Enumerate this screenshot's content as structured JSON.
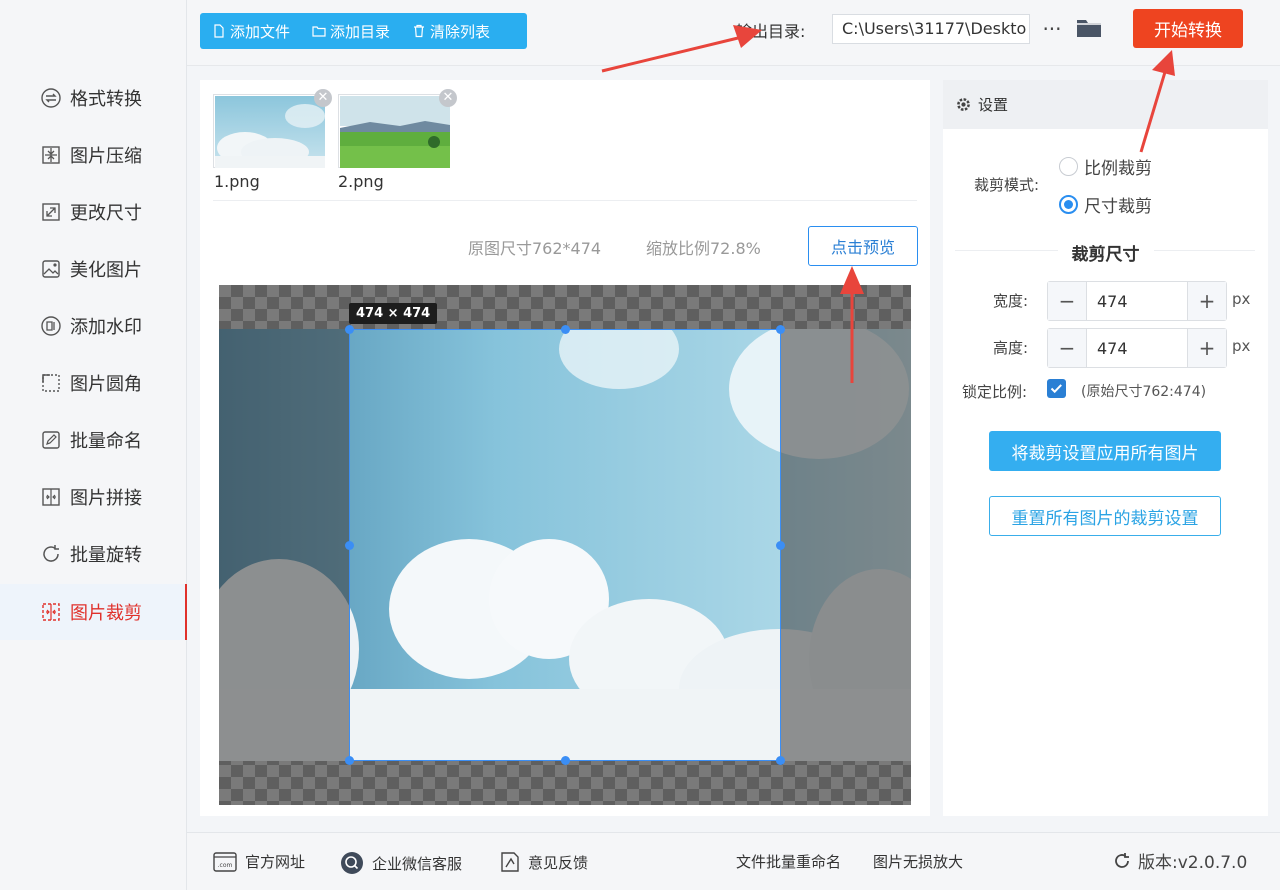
{
  "sidebar": {
    "items": [
      {
        "label": "格式转换",
        "icon": "format-convert-icon"
      },
      {
        "label": "图片压缩",
        "icon": "compress-icon"
      },
      {
        "label": "更改尺寸",
        "icon": "resize-icon"
      },
      {
        "label": "美化图片",
        "icon": "beautify-icon"
      },
      {
        "label": "添加水印",
        "icon": "watermark-icon"
      },
      {
        "label": "图片圆角",
        "icon": "rounded-corner-icon"
      },
      {
        "label": "批量命名",
        "icon": "rename-icon"
      },
      {
        "label": "图片拼接",
        "icon": "stitch-icon"
      },
      {
        "label": "批量旋转",
        "icon": "rotate-icon"
      },
      {
        "label": "图片裁剪",
        "icon": "crop-icon",
        "active": true
      }
    ]
  },
  "toolbar": {
    "add_file": "添加文件",
    "add_dir": "添加目录",
    "clear_list": "清除列表",
    "output_label": "输出目录:",
    "output_path": "C:\\Users\\31177\\Deskto",
    "more": "···",
    "start": "开始转换"
  },
  "files": [
    {
      "name": "1.png"
    },
    {
      "name": "2.png"
    }
  ],
  "preview": {
    "original_size": "原图尺寸762*474",
    "zoom": "缩放比例72.8%",
    "preview_button": "点击预览",
    "crop_tag": "474 × 474"
  },
  "settings": {
    "header": "设置",
    "crop_mode_label": "裁剪模式:",
    "mode_ratio": "比例裁剪",
    "mode_size": "尺寸裁剪",
    "selected_mode": "尺寸裁剪",
    "section_title": "裁剪尺寸",
    "width_label": "宽度:",
    "width_value": "474",
    "height_label": "高度:",
    "height_value": "474",
    "unit": "px",
    "minus": "−",
    "plus": "+",
    "lock_label": "锁定比例:",
    "lock_checked": true,
    "lock_note": "(原始尺寸762:474)",
    "apply_all": "将裁剪设置应用所有图片",
    "reset_all": "重置所有图片的裁剪设置"
  },
  "footer": {
    "website": "官方网址",
    "wechat": "企业微信客服",
    "feedback": "意见反馈",
    "batch_rename": "文件批量重命名",
    "lossless": "图片无损放大",
    "version": "版本:v2.0.7.0"
  },
  "colors": {
    "accent_blue": "#2aaef0",
    "start_red": "#ee4420",
    "active_red": "#e0312b",
    "arrow_red": "#e8453c"
  }
}
